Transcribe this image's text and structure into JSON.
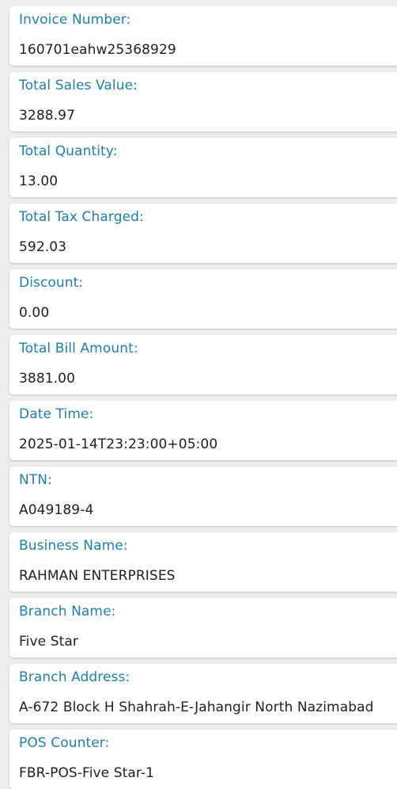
{
  "fields": [
    {
      "label": "Invoice Number:",
      "value": "160701eahw25368929"
    },
    {
      "label": "Total Sales Value:",
      "value": "3288.97"
    },
    {
      "label": "Total Quantity:",
      "value": "13.00"
    },
    {
      "label": "Total Tax Charged:",
      "value": "592.03"
    },
    {
      "label": "Discount:",
      "value": "0.00"
    },
    {
      "label": "Total Bill Amount:",
      "value": "3881.00"
    },
    {
      "label": "Date Time:",
      "value": "2025-01-14T23:23:00+05:00"
    },
    {
      "label": "NTN:",
      "value": "A049189-4"
    },
    {
      "label": "Business Name:",
      "value": "RAHMAN ENTERPRISES"
    },
    {
      "label": "Branch Name:",
      "value": "Five Star"
    },
    {
      "label": "Branch Address:",
      "value": "A-672 Block H Shahrah-E-Jahangir North Nazimabad"
    },
    {
      "label": "POS Counter:",
      "value": "FBR-POS-Five Star-1"
    }
  ],
  "colors": {
    "label": "#1e7fab",
    "value": "#202020",
    "card": "#ffffff",
    "background": "#ececec"
  }
}
